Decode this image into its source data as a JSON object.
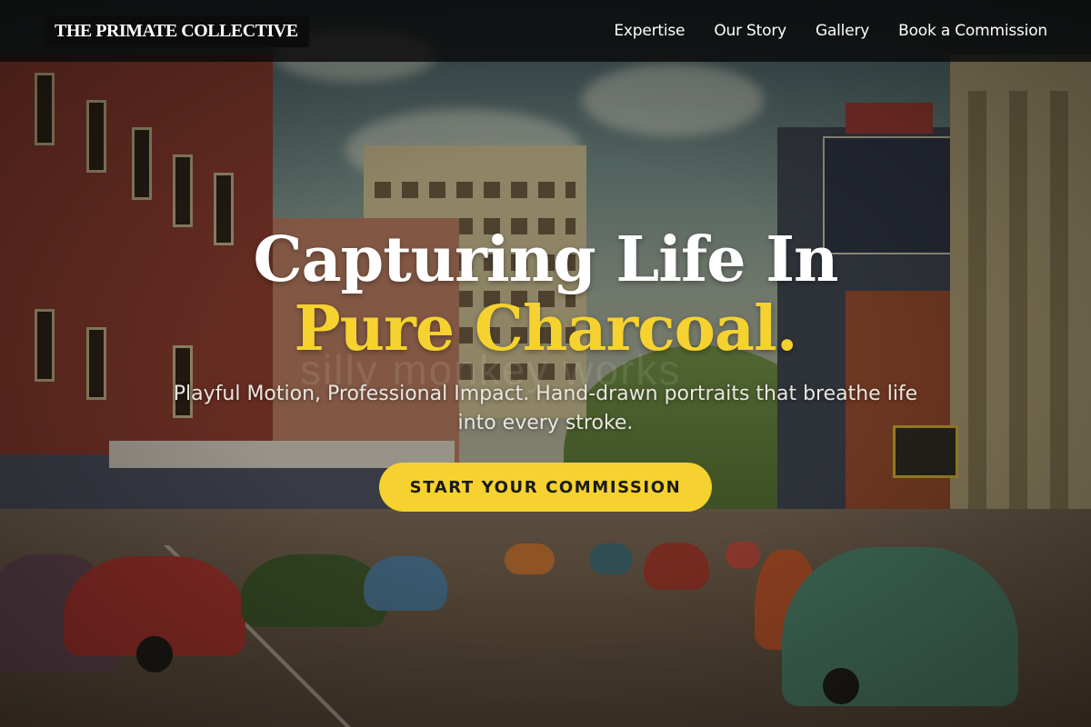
{
  "brand": {
    "name": "THE PRIMATE COLLECTIVE"
  },
  "nav": {
    "items": [
      {
        "label": "Expertise"
      },
      {
        "label": "Our Story"
      },
      {
        "label": "Gallery"
      },
      {
        "label": "Book a Commission"
      }
    ]
  },
  "hero": {
    "headline_part1": "Capturing Life In ",
    "headline_accent": "Pure Charcoal.",
    "subtitle": "Playful Motion, Professional Impact. Hand-drawn portraits that breathe life into every stroke.",
    "cta_label": "START YOUR COMMISSION"
  },
  "background": {
    "description_icon": "vintage-street-postcard-image",
    "watermark_text": "silly monkey works"
  },
  "colors": {
    "accent": "#f5d22f",
    "navbar_bg": "#0a0a0a",
    "text_light": "#ffffff"
  }
}
